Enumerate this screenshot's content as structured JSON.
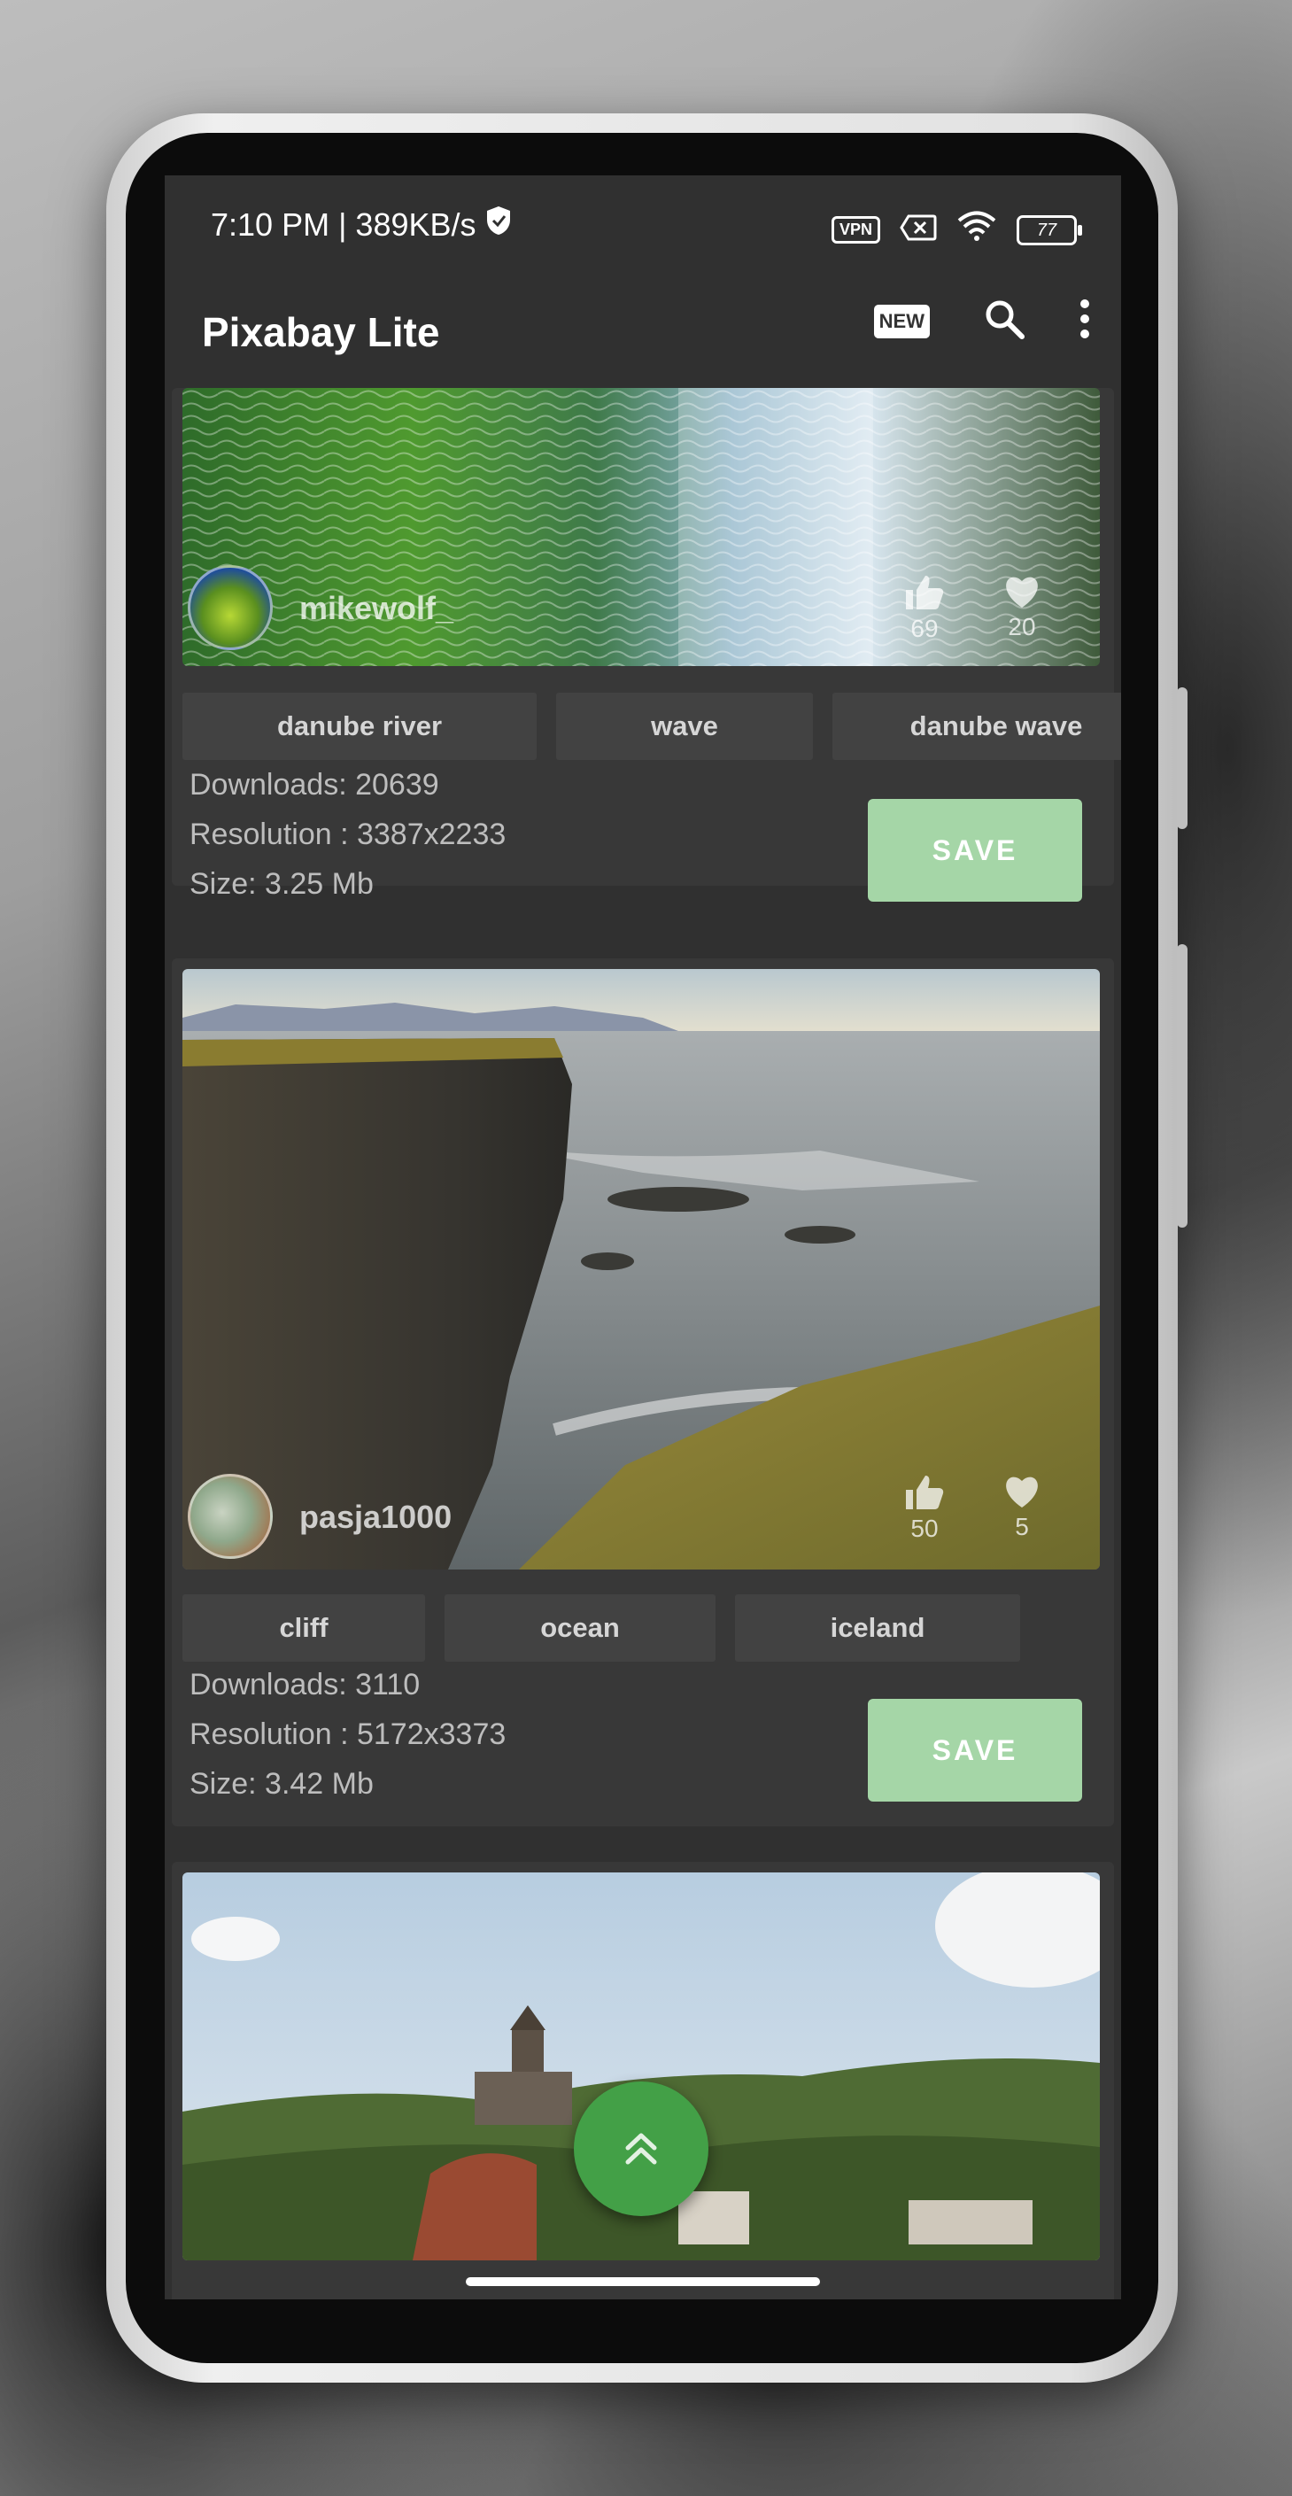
{
  "status_bar": {
    "time_speed": "7:10 PM | 389KB/s",
    "vpn": "VPN",
    "battery": "77"
  },
  "app_bar": {
    "title": "Pixabay Lite",
    "new_badge": "NEW"
  },
  "cards": [
    {
      "author": "mikewolf_",
      "likes": "69",
      "favorites": "20",
      "tags": [
        "danube river",
        "wave",
        "danube wave"
      ],
      "downloads": "Downloads: 20639",
      "resolution": "Resolution : 3387x2233",
      "size": "Size: 3.25 Mb",
      "save_label": "SAVE"
    },
    {
      "author": "pasja1000",
      "likes": "50",
      "favorites": "5",
      "tags": [
        "cliff",
        "ocean",
        "iceland"
      ],
      "downloads": "Downloads: 3110",
      "resolution": "Resolution : 5172x3373",
      "size": "Size: 3.42 Mb",
      "save_label": "SAVE"
    }
  ],
  "colors": {
    "background": "#303030",
    "card": "#383838",
    "tag": "#424242",
    "save_button": "#a5d6a7",
    "fab": "#43a047"
  },
  "icons": [
    "shield-icon",
    "close-box-icon",
    "wifi-icon",
    "search-icon",
    "more-vert-icon",
    "thumb-up-icon",
    "heart-icon",
    "double-chevron-up-icon"
  ]
}
